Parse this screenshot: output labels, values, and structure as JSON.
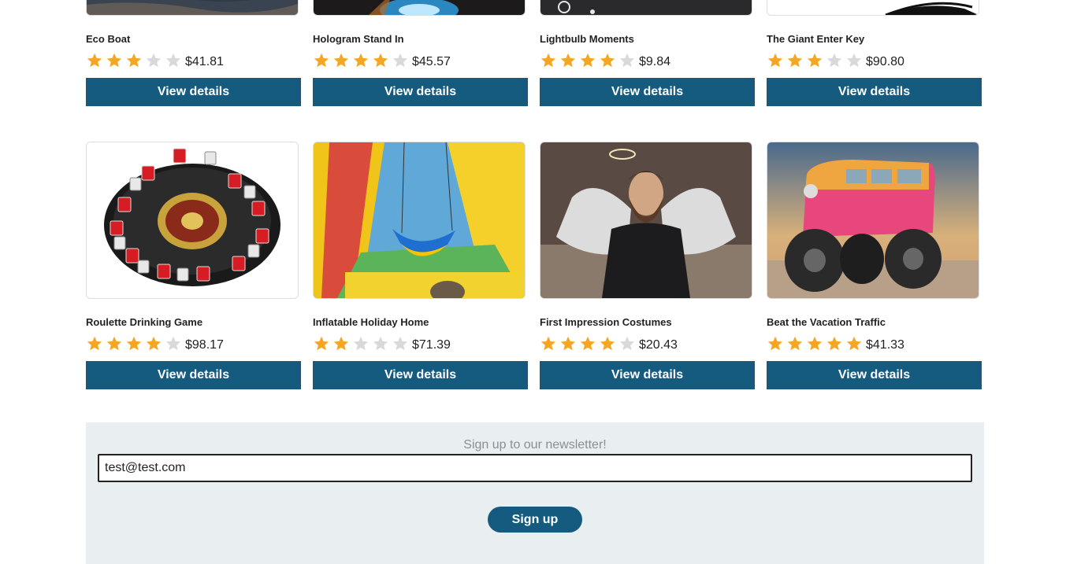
{
  "colors": {
    "primary": "#155a7f",
    "star_filled": "#f5a623",
    "star_empty": "#d9d9d9",
    "newsletter_bg": "#e9eef1"
  },
  "products_top": [
    {
      "name": "Eco Boat",
      "rating": 3,
      "max_rating": 5,
      "price": "$41.81",
      "button": "View details",
      "image": "eco-boat-image"
    },
    {
      "name": "Hologram Stand In",
      "rating": 4,
      "max_rating": 5,
      "price": "$45.57",
      "button": "View details",
      "image": "hologram-image"
    },
    {
      "name": "Lightbulb Moments",
      "rating": 4,
      "max_rating": 5,
      "price": "$9.84",
      "button": "View details",
      "image": "lightbulb-image"
    },
    {
      "name": "The Giant Enter Key",
      "rating": 3,
      "max_rating": 5,
      "price": "$90.80",
      "button": "View details",
      "image": "enter-key-image"
    }
  ],
  "products_bottom": [
    {
      "name": "Roulette Drinking Game",
      "rating": 4,
      "max_rating": 5,
      "price": "$98.17",
      "button": "View details",
      "image": "roulette-image"
    },
    {
      "name": "Inflatable Holiday Home",
      "rating": 2,
      "max_rating": 5,
      "price": "$71.39",
      "button": "View details",
      "image": "inflatable-image"
    },
    {
      "name": "First Impression Costumes",
      "rating": 4,
      "max_rating": 5,
      "price": "$20.43",
      "button": "View details",
      "image": "angel-costume-image"
    },
    {
      "name": "Beat the Vacation Traffic",
      "rating": 5,
      "max_rating": 5,
      "price": "$41.33",
      "button": "View details",
      "image": "monster-van-image"
    }
  ],
  "newsletter": {
    "heading": "Sign up to our newsletter!",
    "email_value": "test@test.com",
    "button": "Sign up"
  }
}
